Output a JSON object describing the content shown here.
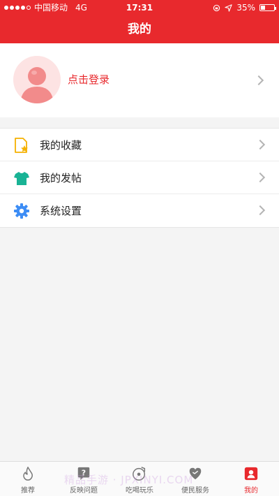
{
  "status_bar": {
    "carrier": "中国移动",
    "network": "4G",
    "time": "17:31",
    "battery_percent": "35%",
    "battery_level": 0.35
  },
  "nav": {
    "title": "我的"
  },
  "login": {
    "label": "点击登录",
    "avatar_icon": "user-avatar-icon"
  },
  "menu": {
    "items": [
      {
        "label": "我的收藏",
        "icon": "favorites-icon",
        "color": "#f5b100"
      },
      {
        "label": "我的发帖",
        "icon": "tshirt-icon",
        "color": "#19b395"
      },
      {
        "label": "系统设置",
        "icon": "gear-icon",
        "color": "#3d8df5"
      }
    ]
  },
  "tabbar": {
    "tabs": [
      {
        "label": "推荐",
        "icon": "flame-icon",
        "active": false
      },
      {
        "label": "反映问题",
        "icon": "question-icon",
        "active": false
      },
      {
        "label": "吃喝玩乐",
        "icon": "music-disc-icon",
        "active": false
      },
      {
        "label": "便民服务",
        "icon": "heart-hand-icon",
        "active": false
      },
      {
        "label": "我的",
        "icon": "profile-icon",
        "active": true
      }
    ]
  },
  "watermark": "精品手游 · JPXINYI.COM",
  "colors": {
    "accent": "#e8292d",
    "background": "#f4f4f4"
  }
}
